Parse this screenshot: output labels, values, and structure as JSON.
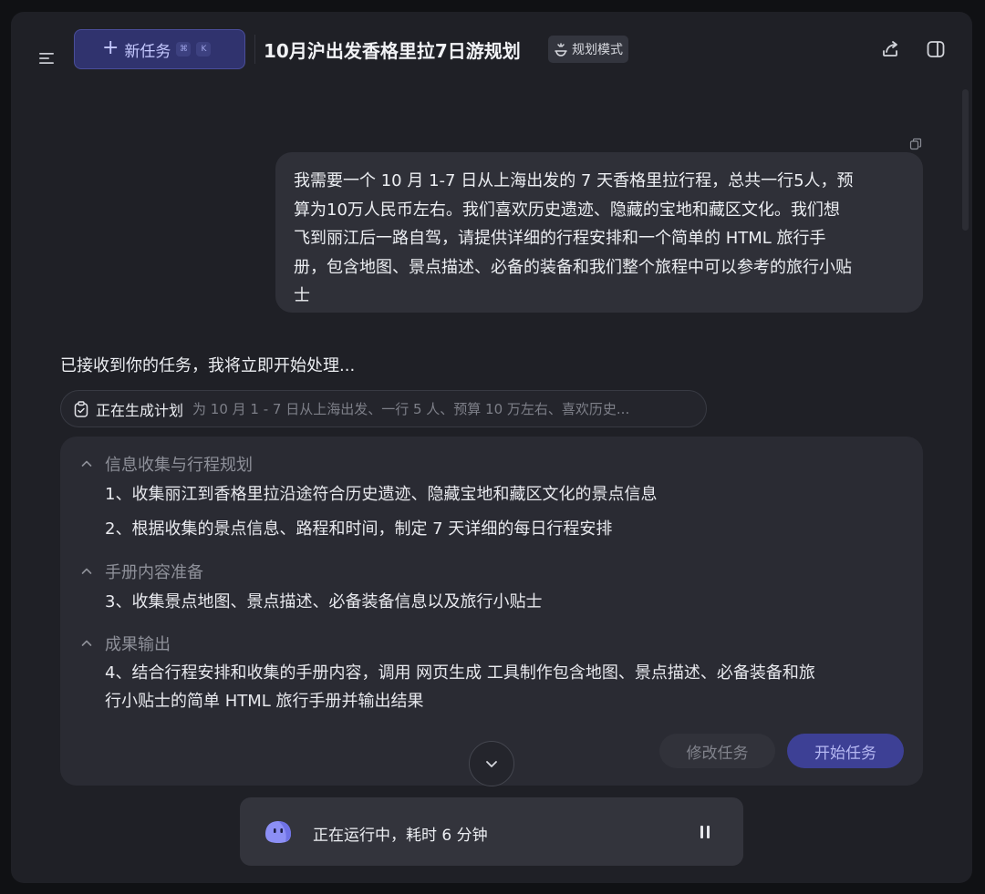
{
  "header": {
    "new_task_label": "新任务",
    "shortcut_keys": [
      "⌘",
      "K"
    ],
    "title": "10月沪出发香格里拉7日游规划",
    "mode_badge": "规划模式"
  },
  "user_message": {
    "lines": [
      "我需要一个 10 月 1-7 日从上海出发的 7 天香格里拉行程，总共一行5人，预",
      "算为10万人民币左右。我们喜欢历史遗迹、隐藏的宝地和藏区文化。我们想",
      "飞到丽江后一路自驾，请提供详细的行程安排和一个简单的 HTML 旅行手",
      "册，包含地图、景点描述、必备的装备和我们整个旅程中可以参考的旅行小贴",
      "士"
    ]
  },
  "assistant": {
    "ack": "已接收到你的任务，我将立即开始处理...",
    "plan_status_label": "正在生成计划",
    "plan_status_desc": "为 10 月 1 - 7 日从上海出发、一行 5 人、预算 10 万左右、喜欢历史..."
  },
  "plan": {
    "sections": [
      {
        "title": "信息收集与行程规划",
        "steps": [
          "1、收集丽江到香格里拉沿途符合历史遗迹、隐藏宝地和藏区文化的景点信息",
          "2、根据收集的景点信息、路程和时间，制定 7 天详细的每日行程安排"
        ]
      },
      {
        "title": "手册内容准备",
        "steps": [
          "3、收集景点地图、景点描述、必备装备信息以及旅行小贴士"
        ]
      },
      {
        "title": "成果输出",
        "steps": [
          "4、结合行程安排和收集的手册内容，调用 网页生成 工具制作包含地图、景点描述、必备装备和旅",
          "行小贴士的简单 HTML 旅行手册并输出结果"
        ]
      }
    ],
    "edit_button": "修改任务",
    "start_button": "开始任务"
  },
  "status_bar": {
    "text": "正在运行中，耗时 6 分钟"
  },
  "colors": {
    "accent": "#3d4095",
    "background": "#1f2026",
    "bubble": "#2f3038"
  }
}
